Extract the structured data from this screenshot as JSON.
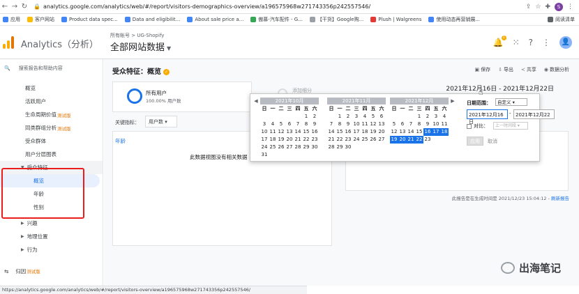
{
  "browser": {
    "url": "analytics.google.com/analytics/web/#/report/visitors-demographics-overview/a196575968w271743356p242557546/",
    "avatar_letter": "S",
    "bookmarks": [
      "应用",
      "客户网站",
      "Product data spec...",
      "Data and eligibilit...",
      "About sale price a...",
      "傲慕-汽车配件 - G...",
      "【干货】Google购...",
      "Plush | Walgreens",
      "使用动态再营销展..."
    ],
    "reading_list": "阅读清单"
  },
  "header": {
    "product": "Analytics（分析）",
    "account_crumb": "所有帐号 > UG-Shopify",
    "view_name": "全部网站数据",
    "notification_count": "1",
    "user_initial": "👤"
  },
  "sidebar": {
    "search_placeholder": "搜索报告和帮助内容",
    "items": [
      "概览",
      "活跃用户",
      "生命周期价值",
      "同类群组分析",
      "受众群体",
      "用户分层图表"
    ],
    "beta_label": "测试版",
    "audience_group": "受众特征",
    "audience_sub": [
      "概览",
      "年龄",
      "性别"
    ],
    "groups_after": [
      "兴趣",
      "地理位置",
      "行为"
    ],
    "attribution": "归因",
    "attribution_beta": "测试版"
  },
  "main": {
    "title": "受众特征：概览",
    "actions": [
      "保存",
      "导出",
      "共享",
      "数据分析"
    ],
    "segment_name": "所有用户",
    "segment_pct": "100.00% 用户数",
    "segment_add": "添加细分",
    "date_range": "2021年12月16日 - 2021年12月22日",
    "metric_label": "关键指标：",
    "metric_value": "用户数",
    "panel_title": "年龄",
    "panel_empty": "此数据视图没有相关数据",
    "footer_note": "此报告是在生成时间是 2021/12/23 15:04:12 - ",
    "footer_link": "刷新报告"
  },
  "picker": {
    "months": [
      "2021年10月",
      "2021年11月",
      "2021年12月"
    ],
    "weekdays": [
      "日",
      "一",
      "二",
      "三",
      "四",
      "五",
      "六"
    ],
    "oct": [
      "",
      "",
      "",
      "",
      "",
      "1",
      "2",
      "3",
      "4",
      "5",
      "6",
      "7",
      "8",
      "9",
      "10",
      "11",
      "12",
      "13",
      "14",
      "15",
      "16",
      "17",
      "18",
      "19",
      "20",
      "21",
      "22",
      "23",
      "24",
      "25",
      "26",
      "27",
      "28",
      "29",
      "30",
      "31"
    ],
    "nov": [
      "",
      "1",
      "2",
      "3",
      "4",
      "5",
      "6",
      "7",
      "8",
      "9",
      "10",
      "11",
      "12",
      "13",
      "14",
      "15",
      "16",
      "17",
      "18",
      "19",
      "20",
      "21",
      "22",
      "23",
      "24",
      "25",
      "26",
      "27",
      "28",
      "29",
      "30"
    ],
    "dec": [
      "",
      "",
      "",
      "1",
      "2",
      "3",
      "4",
      "5",
      "6",
      "7",
      "8",
      "9",
      "10",
      "11",
      "12",
      "13",
      "14",
      "15",
      "16",
      "17",
      "18",
      "19",
      "20",
      "21",
      "22",
      "23"
    ],
    "selected_days": [
      "16",
      "17",
      "18",
      "19",
      "20",
      "21",
      "22"
    ],
    "range_label": "日期范围：",
    "range_mode": "自定义",
    "start": "2021年12月16日",
    "end": "2021年12月22日",
    "compare_label": "对比：",
    "compare_mode": "上一时间段",
    "apply": "应用",
    "cancel": "取消"
  },
  "statusbar": "https://analytics.google.com/analytics/web/#/report/visitors-overview/a196575968w271743356p242557546/",
  "watermark": "出海笔记",
  "colors": {
    "accent": "#1a73e8",
    "beta": "#e37400",
    "highlight": "#ea1c1c"
  }
}
